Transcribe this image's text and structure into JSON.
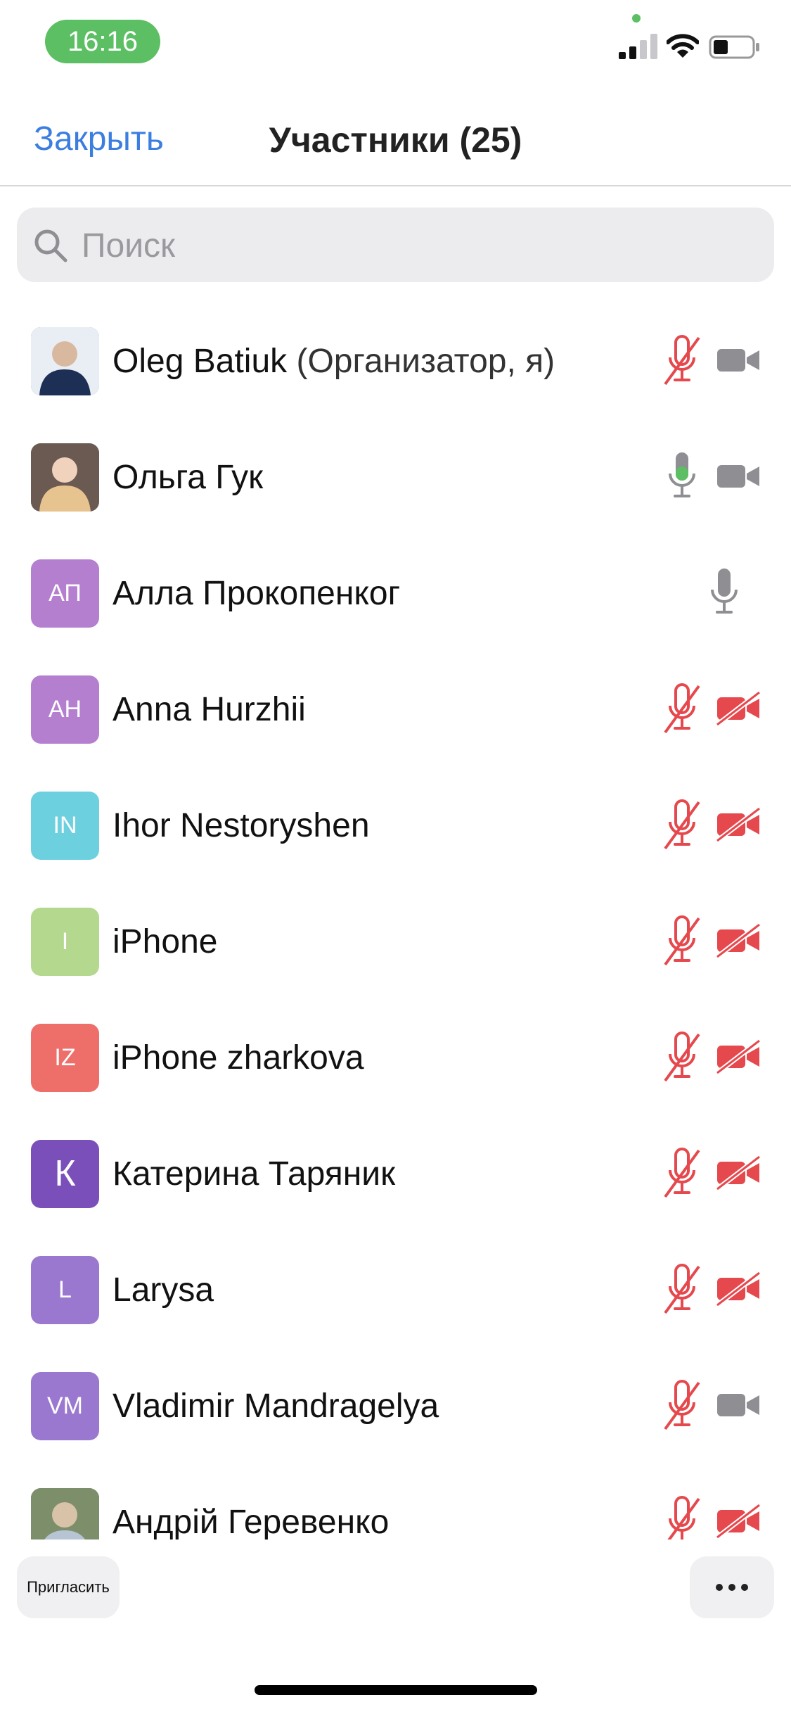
{
  "status_bar": {
    "time": "16:16"
  },
  "header": {
    "close_label": "Закрыть",
    "title": "Участники (25)"
  },
  "search": {
    "placeholder": "Поиск"
  },
  "colors": {
    "accent": "#3b7ee0",
    "muted_red": "#e5484d",
    "active_green": "#5cbf63",
    "icon_gray": "#8e8e93"
  },
  "participants": [
    {
      "name": "Oleg Batiuk",
      "role": "(Организатор, я)",
      "avatar": "photo",
      "mic": "muted",
      "video": "on"
    },
    {
      "name": "Ольга Гук",
      "role": "",
      "avatar": "photo",
      "mic": "active",
      "video": "on"
    },
    {
      "name": "Алла Прокопенког",
      "role": "",
      "initials": "АП",
      "avatar_color": "#b57fcf",
      "mic": "on",
      "video": "none"
    },
    {
      "name": "Anna Hurzhii",
      "role": "",
      "initials": "AH",
      "avatar_color": "#b57fcf",
      "mic": "muted",
      "video": "off"
    },
    {
      "name": "Ihor Nestoryshen",
      "role": "",
      "initials": "IN",
      "avatar_color": "#6dd0df",
      "mic": "muted",
      "video": "off"
    },
    {
      "name": "iPhone",
      "role": "",
      "initials": "I",
      "avatar_color": "#b3d88e",
      "mic": "muted",
      "video": "off"
    },
    {
      "name": "iPhone zharkova",
      "role": "",
      "initials": "IZ",
      "avatar_color": "#ee6e6a",
      "mic": "muted",
      "video": "off"
    },
    {
      "name": "Катерина Таряник",
      "role": "",
      "initials": "К",
      "avatar_color": "#7b4fba",
      "mic": "muted",
      "video": "off"
    },
    {
      "name": "Larysa",
      "role": "",
      "initials": "L",
      "avatar_color": "#9a78cf",
      "mic": "muted",
      "video": "off"
    },
    {
      "name": "Vladimir Mandragelya",
      "role": "",
      "initials": "VM",
      "avatar_color": "#9a78cf",
      "mic": "muted",
      "video": "on"
    },
    {
      "name": "Андрій Геревенко",
      "role": "",
      "avatar": "photo",
      "mic": "muted",
      "video": "off"
    }
  ],
  "footer": {
    "invite_label": "Пригласить"
  }
}
